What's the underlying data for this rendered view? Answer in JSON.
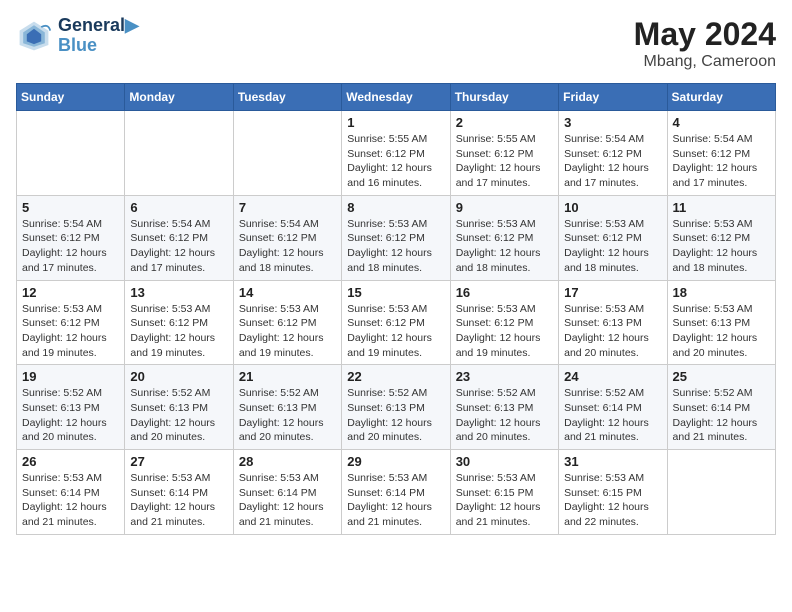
{
  "header": {
    "logo_line1": "General",
    "logo_line2": "Blue",
    "month_title": "May 2024",
    "location": "Mbang, Cameroon"
  },
  "weekdays": [
    "Sunday",
    "Monday",
    "Tuesday",
    "Wednesday",
    "Thursday",
    "Friday",
    "Saturday"
  ],
  "weeks": [
    [
      {
        "day": "",
        "info": ""
      },
      {
        "day": "",
        "info": ""
      },
      {
        "day": "",
        "info": ""
      },
      {
        "day": "1",
        "info": "Sunrise: 5:55 AM\nSunset: 6:12 PM\nDaylight: 12 hours\nand 16 minutes."
      },
      {
        "day": "2",
        "info": "Sunrise: 5:55 AM\nSunset: 6:12 PM\nDaylight: 12 hours\nand 17 minutes."
      },
      {
        "day": "3",
        "info": "Sunrise: 5:54 AM\nSunset: 6:12 PM\nDaylight: 12 hours\nand 17 minutes."
      },
      {
        "day": "4",
        "info": "Sunrise: 5:54 AM\nSunset: 6:12 PM\nDaylight: 12 hours\nand 17 minutes."
      }
    ],
    [
      {
        "day": "5",
        "info": "Sunrise: 5:54 AM\nSunset: 6:12 PM\nDaylight: 12 hours\nand 17 minutes."
      },
      {
        "day": "6",
        "info": "Sunrise: 5:54 AM\nSunset: 6:12 PM\nDaylight: 12 hours\nand 17 minutes."
      },
      {
        "day": "7",
        "info": "Sunrise: 5:54 AM\nSunset: 6:12 PM\nDaylight: 12 hours\nand 18 minutes."
      },
      {
        "day": "8",
        "info": "Sunrise: 5:53 AM\nSunset: 6:12 PM\nDaylight: 12 hours\nand 18 minutes."
      },
      {
        "day": "9",
        "info": "Sunrise: 5:53 AM\nSunset: 6:12 PM\nDaylight: 12 hours\nand 18 minutes."
      },
      {
        "day": "10",
        "info": "Sunrise: 5:53 AM\nSunset: 6:12 PM\nDaylight: 12 hours\nand 18 minutes."
      },
      {
        "day": "11",
        "info": "Sunrise: 5:53 AM\nSunset: 6:12 PM\nDaylight: 12 hours\nand 18 minutes."
      }
    ],
    [
      {
        "day": "12",
        "info": "Sunrise: 5:53 AM\nSunset: 6:12 PM\nDaylight: 12 hours\nand 19 minutes."
      },
      {
        "day": "13",
        "info": "Sunrise: 5:53 AM\nSunset: 6:12 PM\nDaylight: 12 hours\nand 19 minutes."
      },
      {
        "day": "14",
        "info": "Sunrise: 5:53 AM\nSunset: 6:12 PM\nDaylight: 12 hours\nand 19 minutes."
      },
      {
        "day": "15",
        "info": "Sunrise: 5:53 AM\nSunset: 6:12 PM\nDaylight: 12 hours\nand 19 minutes."
      },
      {
        "day": "16",
        "info": "Sunrise: 5:53 AM\nSunset: 6:12 PM\nDaylight: 12 hours\nand 19 minutes."
      },
      {
        "day": "17",
        "info": "Sunrise: 5:53 AM\nSunset: 6:13 PM\nDaylight: 12 hours\nand 20 minutes."
      },
      {
        "day": "18",
        "info": "Sunrise: 5:53 AM\nSunset: 6:13 PM\nDaylight: 12 hours\nand 20 minutes."
      }
    ],
    [
      {
        "day": "19",
        "info": "Sunrise: 5:52 AM\nSunset: 6:13 PM\nDaylight: 12 hours\nand 20 minutes."
      },
      {
        "day": "20",
        "info": "Sunrise: 5:52 AM\nSunset: 6:13 PM\nDaylight: 12 hours\nand 20 minutes."
      },
      {
        "day": "21",
        "info": "Sunrise: 5:52 AM\nSunset: 6:13 PM\nDaylight: 12 hours\nand 20 minutes."
      },
      {
        "day": "22",
        "info": "Sunrise: 5:52 AM\nSunset: 6:13 PM\nDaylight: 12 hours\nand 20 minutes."
      },
      {
        "day": "23",
        "info": "Sunrise: 5:52 AM\nSunset: 6:13 PM\nDaylight: 12 hours\nand 20 minutes."
      },
      {
        "day": "24",
        "info": "Sunrise: 5:52 AM\nSunset: 6:14 PM\nDaylight: 12 hours\nand 21 minutes."
      },
      {
        "day": "25",
        "info": "Sunrise: 5:52 AM\nSunset: 6:14 PM\nDaylight: 12 hours\nand 21 minutes."
      }
    ],
    [
      {
        "day": "26",
        "info": "Sunrise: 5:53 AM\nSunset: 6:14 PM\nDaylight: 12 hours\nand 21 minutes."
      },
      {
        "day": "27",
        "info": "Sunrise: 5:53 AM\nSunset: 6:14 PM\nDaylight: 12 hours\nand 21 minutes."
      },
      {
        "day": "28",
        "info": "Sunrise: 5:53 AM\nSunset: 6:14 PM\nDaylight: 12 hours\nand 21 minutes."
      },
      {
        "day": "29",
        "info": "Sunrise: 5:53 AM\nSunset: 6:14 PM\nDaylight: 12 hours\nand 21 minutes."
      },
      {
        "day": "30",
        "info": "Sunrise: 5:53 AM\nSunset: 6:15 PM\nDaylight: 12 hours\nand 21 minutes."
      },
      {
        "day": "31",
        "info": "Sunrise: 5:53 AM\nSunset: 6:15 PM\nDaylight: 12 hours\nand 22 minutes."
      },
      {
        "day": "",
        "info": ""
      }
    ]
  ]
}
